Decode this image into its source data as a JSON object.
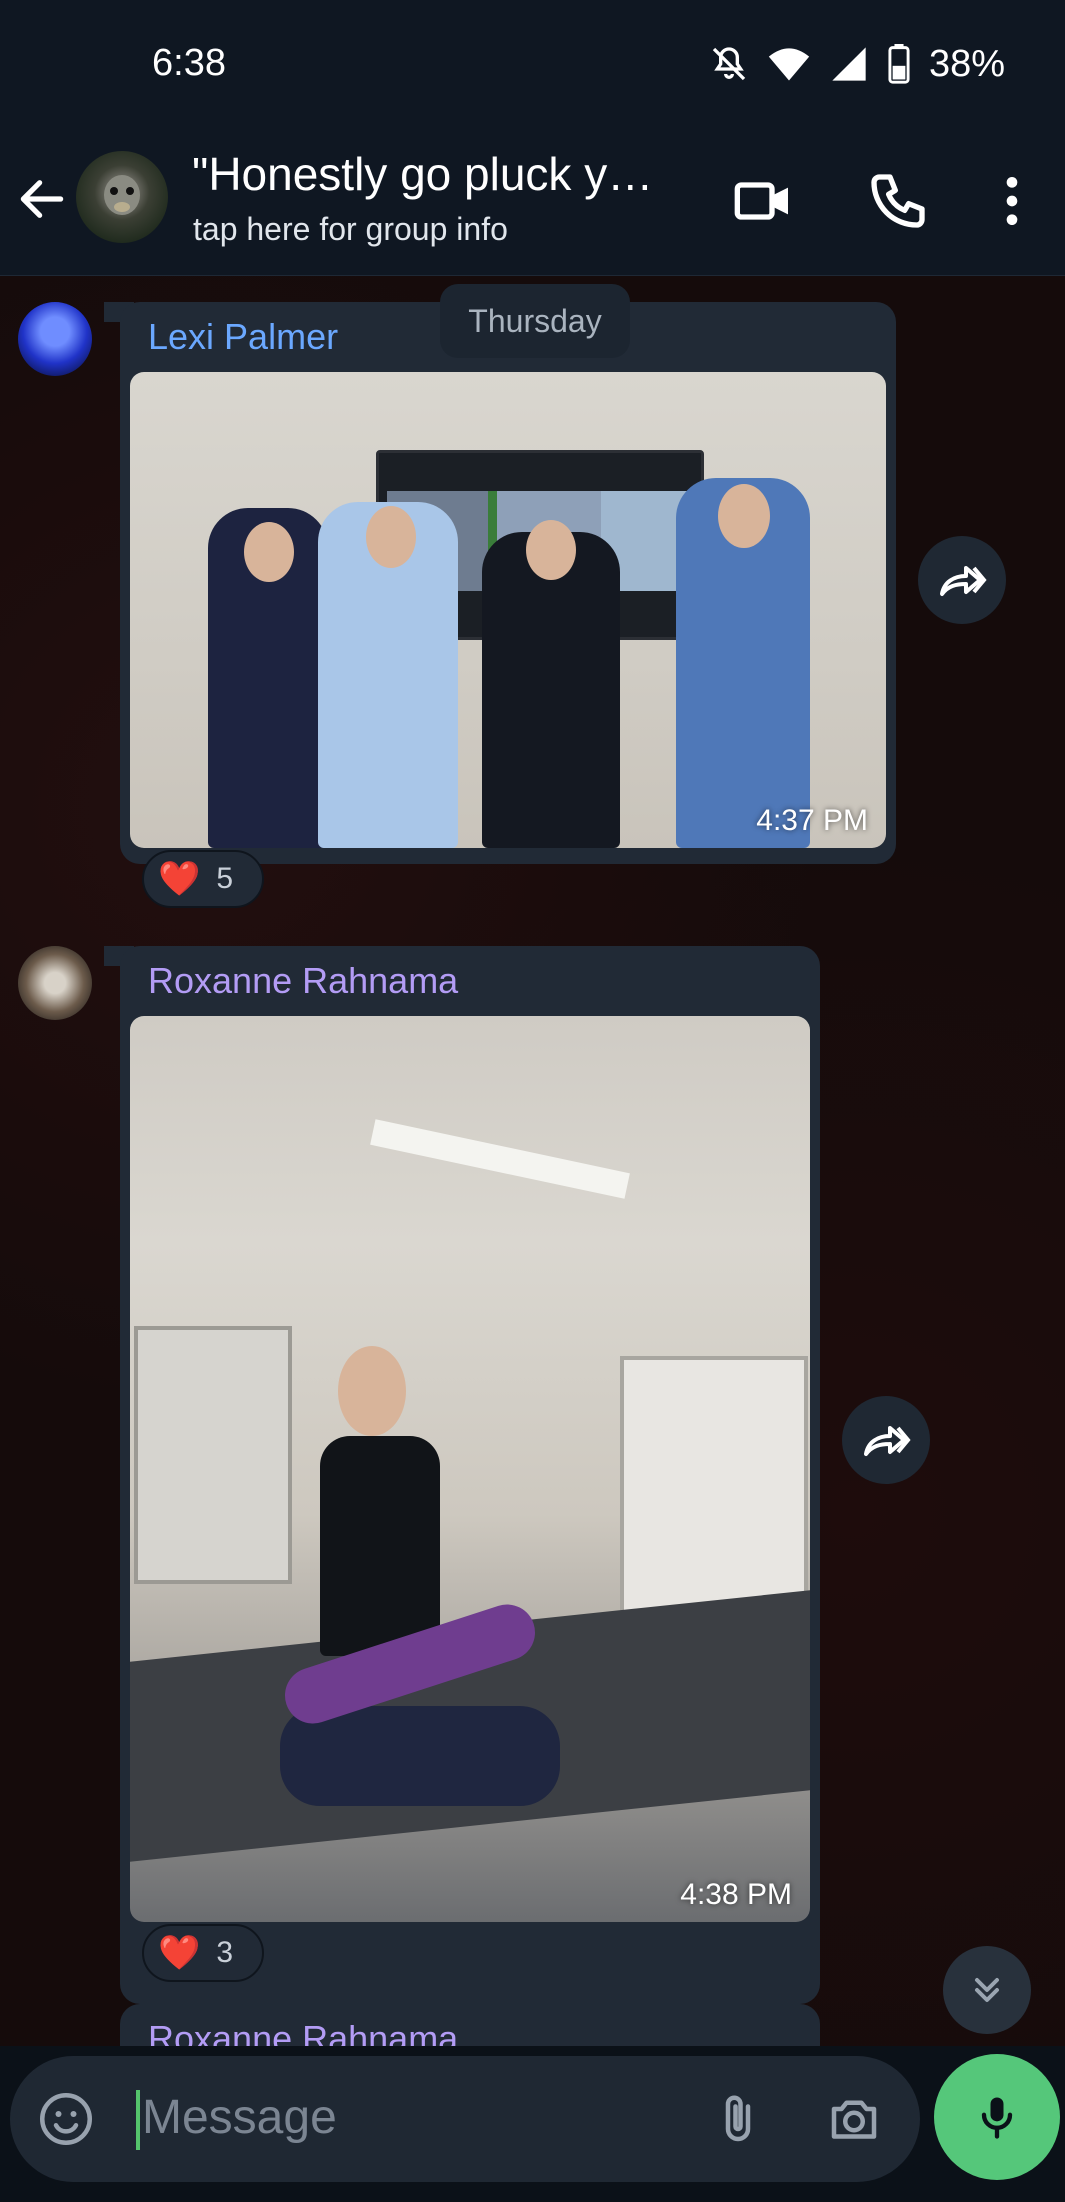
{
  "status_bar": {
    "time": "6:38",
    "battery": "38%"
  },
  "header": {
    "title": "\"Honestly go pluck y…",
    "subtitle": "tap here for group info"
  },
  "chat": {
    "day_separator": "Thursday",
    "messages": [
      {
        "sender": "Lexi Palmer",
        "sender_color": "#6ba8ff",
        "time": "4:37 PM",
        "reaction_emoji": "❤️",
        "reaction_count": "5"
      },
      {
        "sender": "Roxanne Rahnama",
        "sender_color": "#b39cf5",
        "time": "4:38 PM",
        "reaction_emoji": "❤️",
        "reaction_count": "3"
      },
      {
        "sender": "Roxanne Rahnama",
        "sender_color": "#b39cf5"
      }
    ]
  },
  "composer": {
    "placeholder": "Message"
  },
  "colors": {
    "accent_green": "#55c77a",
    "bubble": "#212a36",
    "bar": "#0f1722"
  }
}
